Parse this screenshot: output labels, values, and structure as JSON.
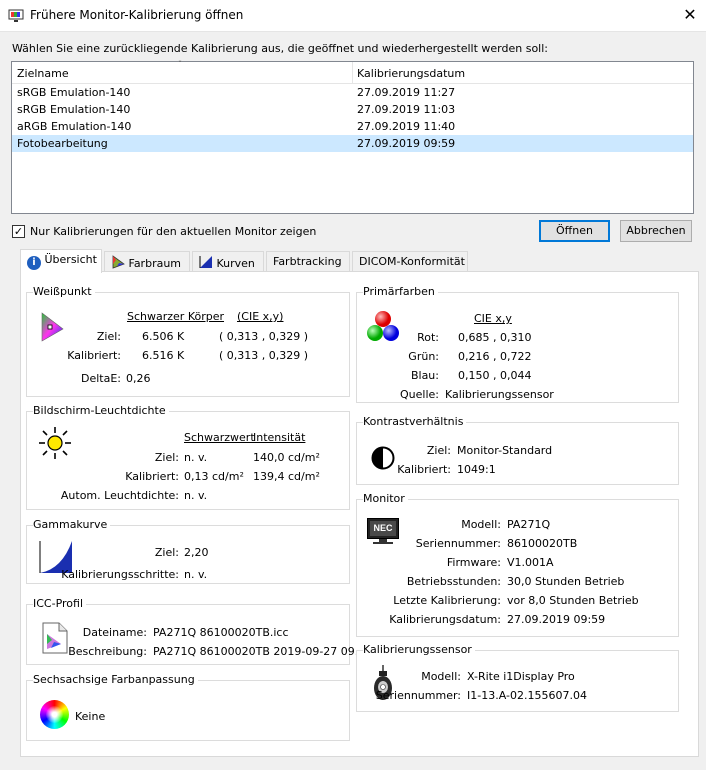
{
  "window": {
    "title": "Frühere Monitor-Kalibrierung öffnen",
    "close_glyph": "✕"
  },
  "instruction": "Wählen Sie eine zurückliegende Kalibrierung aus, die geöffnet und wiederhergestellt werden soll:",
  "list": {
    "columns": [
      "Zielname",
      "Kalibrierungsdatum"
    ],
    "rows": [
      {
        "name": "sRGB Emulation-140",
        "date": "27.09.2019 11:27"
      },
      {
        "name": "sRGB Emulation-140",
        "date": "27.09.2019 11:03"
      },
      {
        "name": "aRGB Emulation-140",
        "date": "27.09.2019 11:40"
      },
      {
        "name": "Fotobearbeitung",
        "date": "27.09.2019 09:59"
      }
    ]
  },
  "filter_checkbox": {
    "label": "Nur Kalibrierungen für den aktuellen Monitor zeigen",
    "checked": true
  },
  "buttons": {
    "open": "Öffnen",
    "cancel": "Abbrechen"
  },
  "tabs": [
    "Übersicht",
    "Farbraum",
    "Kurven",
    "Farbtracking",
    "DICOM-Konformität"
  ],
  "whitepoint": {
    "title": "Weißpunkt",
    "col1": "Schwarzer Körper",
    "col2": "(CIE x,y)",
    "target_label": "Ziel:",
    "target_k": "6.506 K",
    "target_xy": "( 0,313 , 0,329 )",
    "cal_label": "Kalibriert:",
    "cal_k": "6.516 K",
    "cal_xy": "( 0,313 , 0,329 )",
    "delta_label": "DeltaE:",
    "delta": "0,26"
  },
  "luminance": {
    "title": "Bildschirm-Leuchtdichte",
    "col1": "Schwarzwert",
    "col2": "Intensität",
    "target_label": "Ziel:",
    "target_black": "n. v.",
    "target_int": "140,0 cd/m²",
    "cal_label": "Kalibriert:",
    "cal_black": "0,13 cd/m²",
    "cal_int": "139,4 cd/m²",
    "auto_label": "Autom. Leuchtdichte:",
    "auto": "n. v."
  },
  "gamma": {
    "title": "Gammakurve",
    "target_label": "Ziel:",
    "target": "2,20",
    "steps_label": "Kalibrierungsschritte:",
    "steps": "n. v."
  },
  "icc": {
    "title": "ICC-Profil",
    "file_label": "Dateiname:",
    "file": "PA271Q 86100020TB.icc",
    "desc_label": "Beschreibung:",
    "desc": "PA271Q 86100020TB 2019-09-27 09..."
  },
  "six_axis": {
    "title": "Sechsachsige Farbanpassung",
    "value": "Keine"
  },
  "primaries": {
    "title": "Primärfarben",
    "col": "CIE x,y",
    "red_label": "Rot:",
    "red": "0,685 , 0,310",
    "green_label": "Grün:",
    "green": "0,216 , 0,722",
    "blue_label": "Blau:",
    "blue": "0,150 , 0,044",
    "source_label": "Quelle:",
    "source": "Kalibrierungssensor"
  },
  "contrast": {
    "title": "Kontrastverhältnis",
    "target_label": "Ziel:",
    "target": "Monitor-Standard",
    "cal_label": "Kalibriert:",
    "cal": "1049:1"
  },
  "monitor": {
    "title": "Monitor",
    "logo_text": "NEC",
    "model_label": "Modell:",
    "model": "PA271Q",
    "serial_label": "Seriennummer:",
    "serial": "86100020TB",
    "fw_label": "Firmware:",
    "fw": "V1.001A",
    "hours_label": "Betriebsstunden:",
    "hours": "30,0 Stunden Betrieb",
    "last_label": "Letzte Kalibrierung:",
    "last": "vor 8,0 Stunden Betrieb",
    "date_label": "Kalibrierungsdatum:",
    "date": "27.09.2019 09:59"
  },
  "sensor": {
    "title": "Kalibrierungssensor",
    "model_label": "Modell:",
    "model": "X-Rite i1Display Pro",
    "serial_label": "Seriennummer:",
    "serial": "I1-13.A-02.155607.04"
  }
}
